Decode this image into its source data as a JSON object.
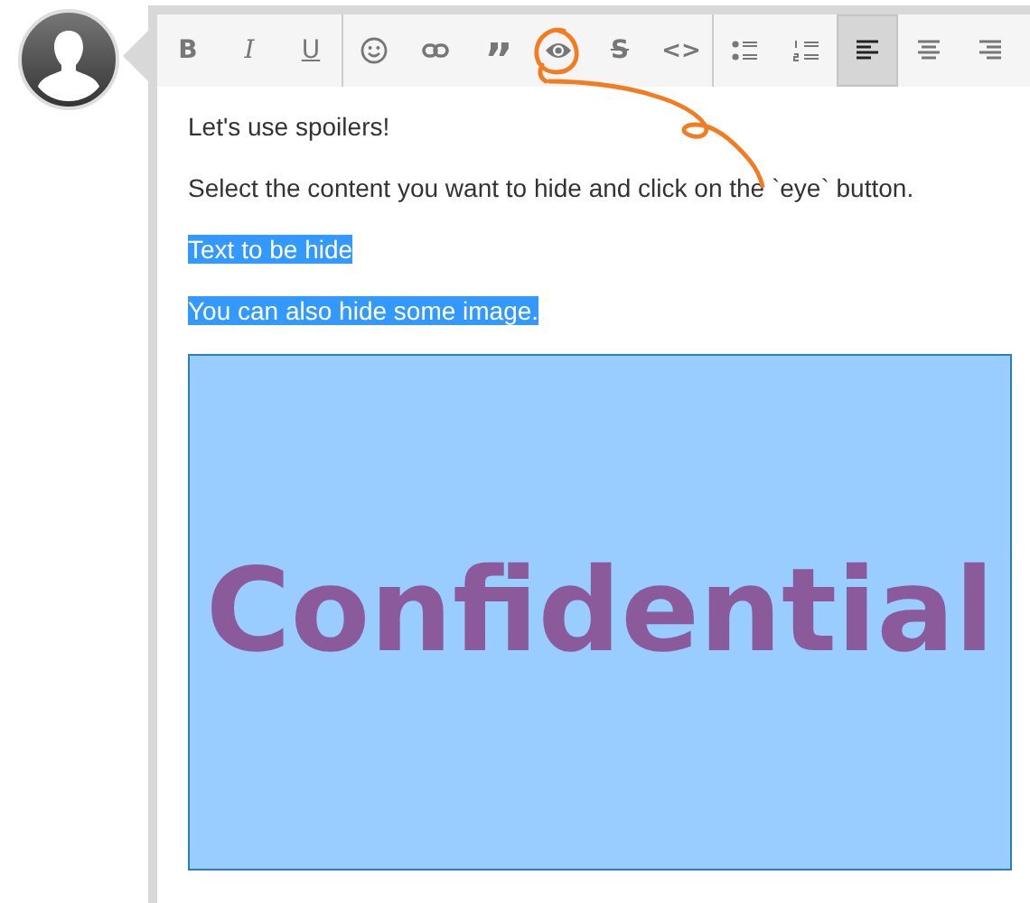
{
  "toolbar": {
    "groups": [
      {
        "buttons": [
          {
            "kind": "bold",
            "label": "B",
            "selected": false
          },
          {
            "kind": "italic",
            "label": "I",
            "selected": false
          },
          {
            "kind": "underline",
            "label": "U",
            "selected": false
          }
        ]
      },
      {
        "buttons": [
          {
            "kind": "emoji",
            "selected": false
          },
          {
            "kind": "link",
            "selected": false
          },
          {
            "kind": "quote",
            "label": "”",
            "selected": false
          },
          {
            "kind": "eye",
            "selected": false
          },
          {
            "kind": "strike",
            "label": "S",
            "selected": false
          },
          {
            "kind": "code",
            "label": "<>",
            "selected": false
          }
        ]
      },
      {
        "buttons": [
          {
            "kind": "bullet-list",
            "selected": false
          },
          {
            "kind": "numbered-list",
            "selected": false
          },
          {
            "kind": "align-left",
            "selected": true
          },
          {
            "kind": "align-center",
            "selected": false
          },
          {
            "kind": "align-right",
            "selected": false
          }
        ]
      }
    ]
  },
  "content": [
    {
      "text": "Let's use spoilers!",
      "selected": false
    },
    {
      "text": "Select the content you want to hide and click on the `eye` button.",
      "selected": false
    },
    {
      "text": "Text to be hide",
      "selected": true
    },
    {
      "text": "You can also hide some image.",
      "selected": true
    }
  ],
  "image": {
    "text": "Confidential",
    "selected": true
  }
}
